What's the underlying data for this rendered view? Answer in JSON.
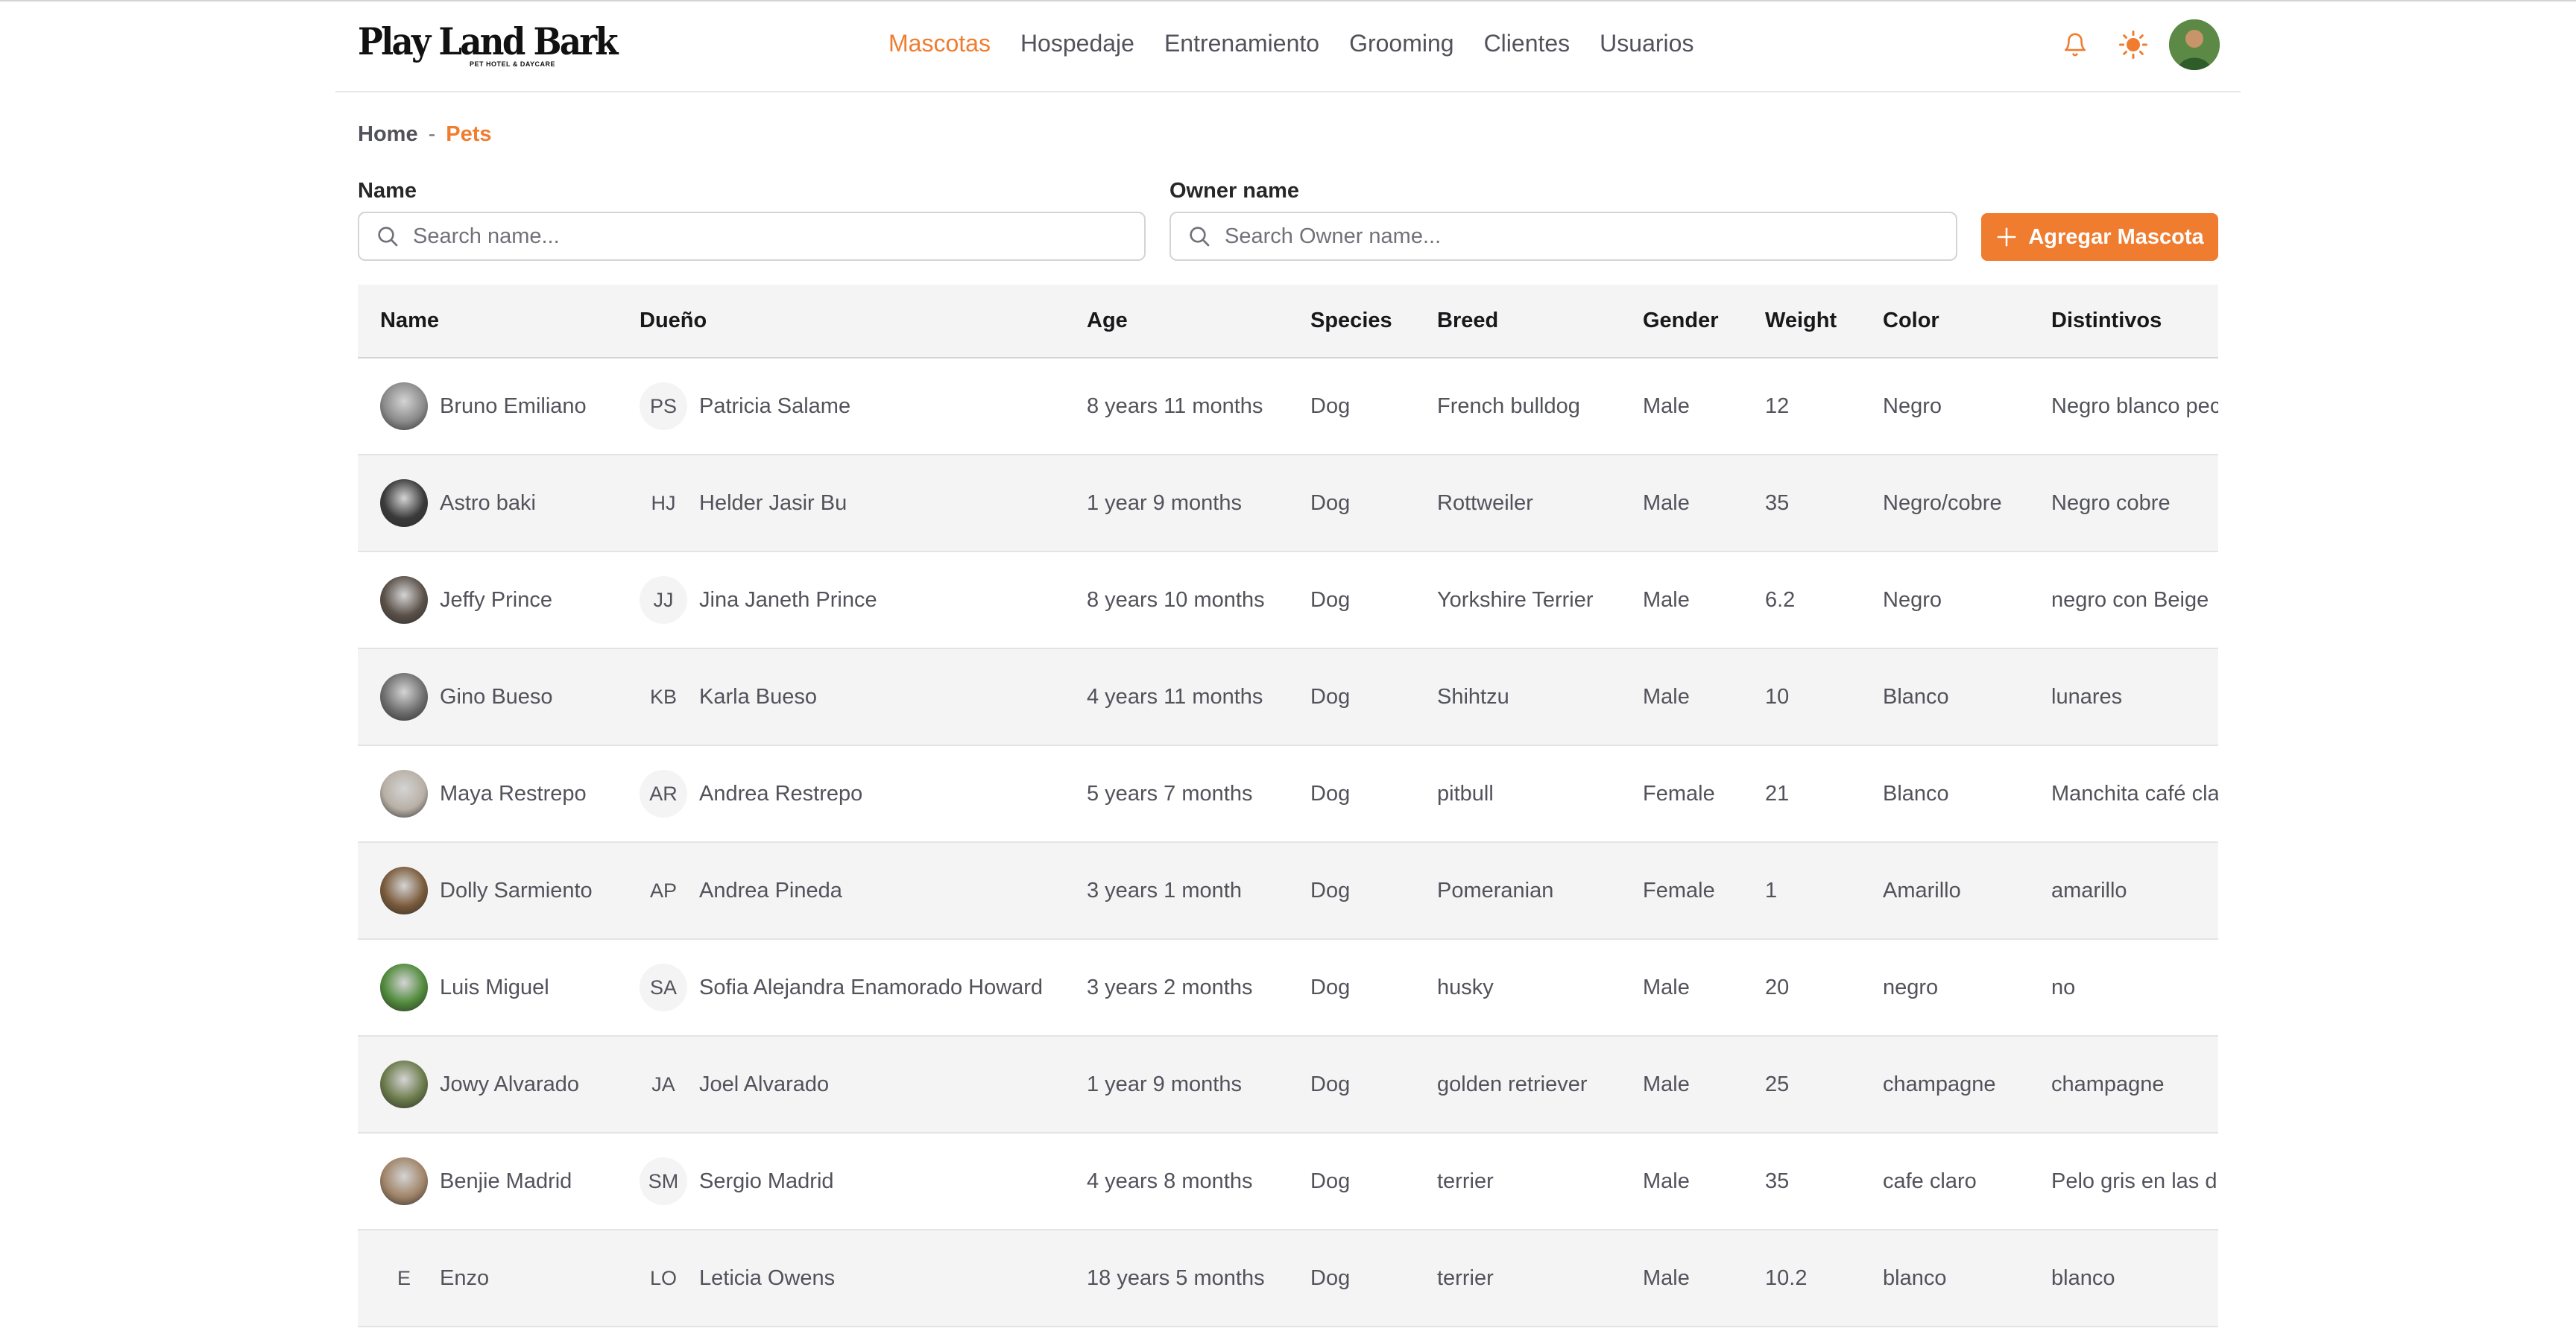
{
  "brand": {
    "logo_text": "Play Land Bark",
    "logo_sub": "PET HOTEL & DAYCARE"
  },
  "nav": {
    "items": [
      "Mascotas",
      "Hospedaje",
      "Entrenamiento",
      "Grooming",
      "Clientes",
      "Usuarios"
    ],
    "active": "Mascotas"
  },
  "header_icons": {
    "notifications": "bell-icon",
    "theme": "sun-icon",
    "user": "user-avatar"
  },
  "breadcrumb": {
    "home": "Home",
    "separator": "-",
    "current": "Pets"
  },
  "filters": {
    "name_label": "Name",
    "name_placeholder": "Search name...",
    "owner_label": "Owner name",
    "owner_placeholder": "Search Owner name...",
    "add_button": "Agregar Mascota"
  },
  "table": {
    "columns": [
      "Name",
      "Dueño",
      "Age",
      "Species",
      "Breed",
      "Gender",
      "Weight",
      "Color",
      "Distintivos"
    ],
    "rows": [
      {
        "name": "Bruno Emiliano",
        "avatar": "",
        "owner_initials": "PS",
        "owner": "Patricia Salame",
        "age": "8 years 11 months",
        "species": "Dog",
        "breed": "French bulldog",
        "gender": "Male",
        "weight": "12",
        "color": "Negro",
        "marks": "Negro blanco pec"
      },
      {
        "name": "Astro baki",
        "avatar": "",
        "owner_initials": "HJ",
        "owner": "Helder Jasir Bu",
        "age": "1 year 9 months",
        "species": "Dog",
        "breed": "Rottweiler",
        "gender": "Male",
        "weight": "35",
        "color": "Negro/cobre",
        "marks": "Negro cobre"
      },
      {
        "name": "Jeffy Prince",
        "avatar": "",
        "owner_initials": "JJ",
        "owner": "Jina Janeth Prince",
        "age": "8 years 10 months",
        "species": "Dog",
        "breed": "Yorkshire Terrier",
        "gender": "Male",
        "weight": "6.2",
        "color": "Negro",
        "marks": "negro con Beige"
      },
      {
        "name": "Gino Bueso",
        "avatar": "",
        "owner_initials": "KB",
        "owner": "Karla Bueso",
        "age": "4 years 11 months",
        "species": "Dog",
        "breed": "Shihtzu",
        "gender": "Male",
        "weight": "10",
        "color": "Blanco",
        "marks": "lunares"
      },
      {
        "name": "Maya Restrepo",
        "avatar": "",
        "owner_initials": "AR",
        "owner": "Andrea Restrepo",
        "age": "5 years 7 months",
        "species": "Dog",
        "breed": "pitbull",
        "gender": "Female",
        "weight": "21",
        "color": "Blanco",
        "marks": "Manchita café cla"
      },
      {
        "name": "Dolly Sarmiento",
        "avatar": "",
        "owner_initials": "AP",
        "owner": "Andrea Pineda",
        "age": "3 years 1 month",
        "species": "Dog",
        "breed": "Pomeranian",
        "gender": "Female",
        "weight": "1",
        "color": "Amarillo",
        "marks": "amarillo"
      },
      {
        "name": "Luis Miguel",
        "avatar": "",
        "owner_initials": "SA",
        "owner": "Sofia Alejandra Enamorado Howard",
        "age": "3 years 2 months",
        "species": "Dog",
        "breed": "husky",
        "gender": "Male",
        "weight": "20",
        "color": "negro",
        "marks": "no"
      },
      {
        "name": "Jowy Alvarado",
        "avatar": "",
        "owner_initials": "JA",
        "owner": "Joel Alvarado",
        "age": "1 year 9 months",
        "species": "Dog",
        "breed": "golden retriever",
        "gender": "Male",
        "weight": "25",
        "color": "champagne",
        "marks": "champagne"
      },
      {
        "name": "Benjie Madrid",
        "avatar": "",
        "owner_initials": "SM",
        "owner": "Sergio Madrid",
        "age": "4 years 8 months",
        "species": "Dog",
        "breed": "terrier",
        "gender": "Male",
        "weight": "35",
        "color": "cafe claro",
        "marks": "Pelo gris en las d"
      },
      {
        "name": "Enzo",
        "avatar": "E",
        "owner_initials": "LO",
        "owner": "Leticia Owens",
        "age": "18 years 5 months",
        "species": "Dog",
        "breed": "terrier",
        "gender": "Male",
        "weight": "10.2",
        "color": "blanco",
        "marks": "blanco"
      }
    ]
  },
  "colors": {
    "accent": "#f07c2f",
    "stripe": "#f4f4f5",
    "border": "#e4e4e7"
  }
}
